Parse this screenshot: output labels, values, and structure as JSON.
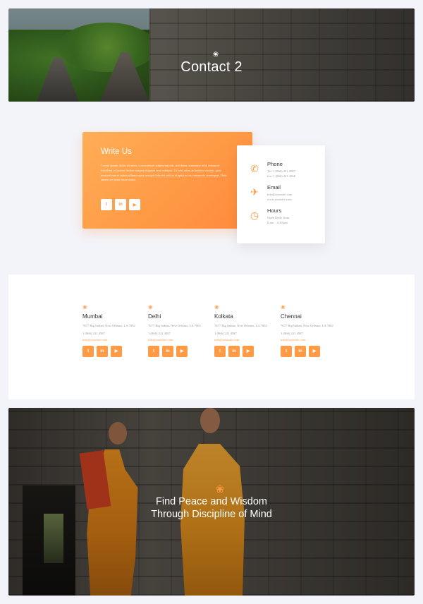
{
  "hero": {
    "title": "Contact 2",
    "lotus_icon": "lotus-icon"
  },
  "write_us": {
    "title": "Write Us",
    "body": "Lorem ipsum dolor sit amet, consectetuer adipiscing elit, sed diam nonummy nibh euismod tincidunt ut laoreet dolore magna aliquam erat volutpat. Ut wisi enim ad minim veniam, quis nostrud exerci tation ullamcorper suscipit lobortis nisl ut aliquip ex ea commodo consequat. Duis autem vel eum iriure dolor.",
    "social": [
      "t",
      "in",
      "▶"
    ]
  },
  "info": {
    "phone": {
      "title": "Phone",
      "lines": [
        "Tel. 1 (866) 221 4587",
        "fax: 1 (866) 221 4568"
      ]
    },
    "email": {
      "title": "Email",
      "lines": [
        "info@yoursite.com",
        "www.yoursite.com"
      ]
    },
    "hours": {
      "title": "Hours",
      "lines": [
        "Open Daily from",
        "8 am – 4:30 pm"
      ]
    }
  },
  "locations": [
    {
      "city": "Mumbai",
      "address": "7677 Big Indian, New Orleans, LA 7002",
      "phone": "1 (866) 221 4587",
      "email": "info@yoursite.com"
    },
    {
      "city": "Delhi",
      "address": "7677 Big Indian, New Orleans, LA 7002",
      "phone": "1 (866) 221 4587",
      "email": "info@yoursite.com"
    },
    {
      "city": "Kolkata",
      "address": "7677 Big Indian, New Orleans, LA 7002",
      "phone": "1 (866) 221 4587",
      "email": "info@yoursite.com"
    },
    {
      "city": "Chennai",
      "address": "7677 Big Indian, New Orleans, LA 7002",
      "phone": "1 (866) 221 4587",
      "email": "info@yoursite.com"
    }
  ],
  "social_labels": {
    "twitter": "t",
    "linkedin": "in",
    "youtube": "▶"
  },
  "banner": {
    "line1": "Find Peace and Wisdom",
    "line2": "Through Discipline of Mind"
  },
  "colors": {
    "accent": "#ff9a45",
    "background": "#f3f4f9"
  }
}
